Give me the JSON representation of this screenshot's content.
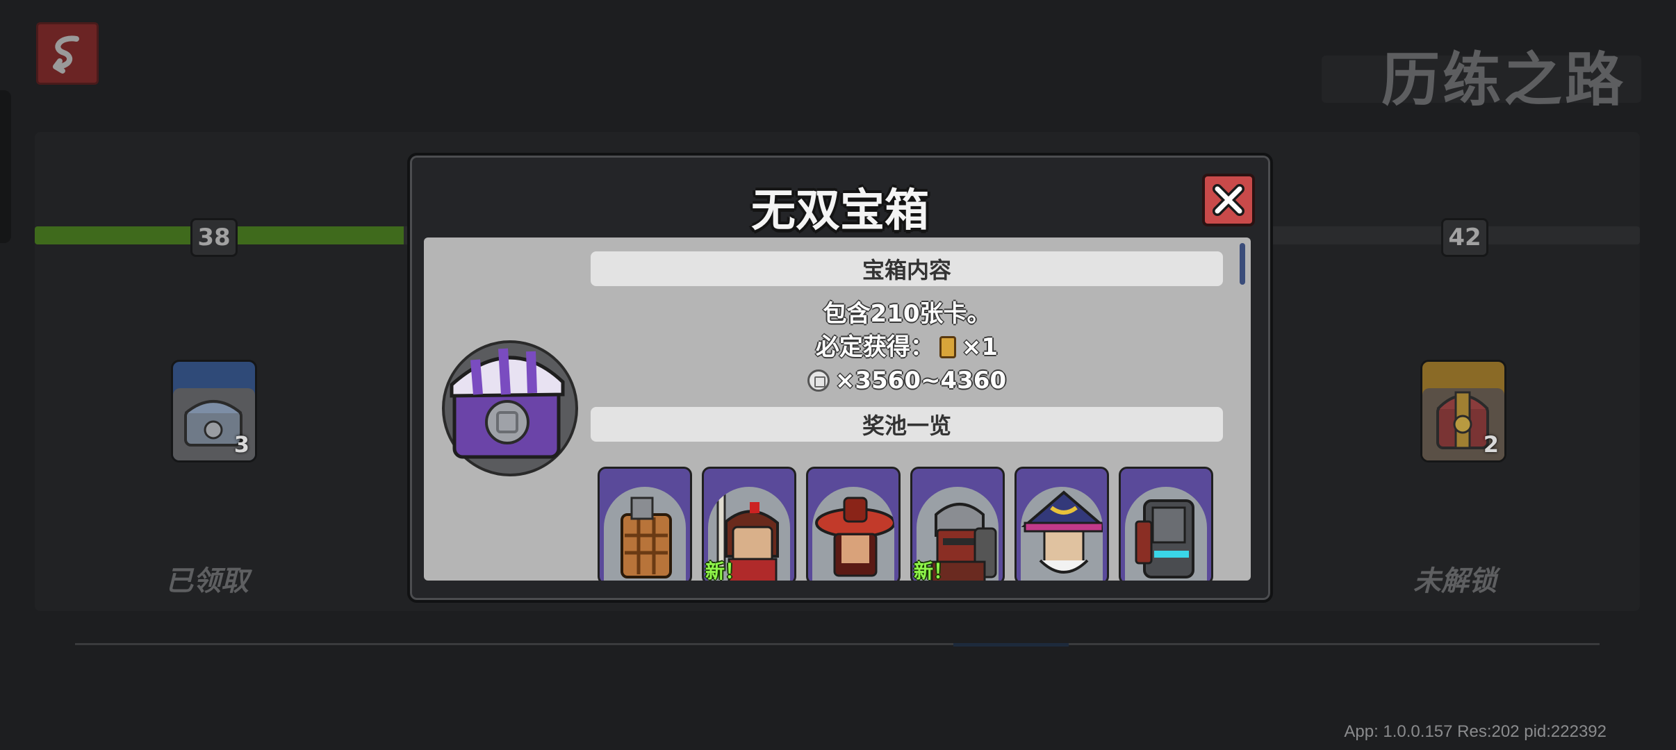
{
  "page": {
    "title": "历练之路",
    "version_info": "App: 1.0.0.157 Res:202 pid:222392"
  },
  "track": {
    "left_level": "38",
    "right_level": "42",
    "left_status": "已领取",
    "right_status": "未解锁",
    "left_chest_count": "3",
    "right_chest_count": "2",
    "progress_fraction": 0.23
  },
  "modal": {
    "title": "无双宝箱",
    "contents_header": "宝箱内容",
    "card_count_text": "包含210张卡。",
    "guaranteed_label": "必定获得：",
    "guaranteed_card_qty": "×1",
    "coin_range": "×3560~4360",
    "pool_header": "奖池一览",
    "cards": [
      {
        "name": "card-crate-hero",
        "new_label": ""
      },
      {
        "name": "card-swordsman-hero",
        "new_label": "新！"
      },
      {
        "name": "card-red-hat-hero",
        "new_label": ""
      },
      {
        "name": "card-armored-hero",
        "new_label": "新！"
      },
      {
        "name": "card-wizard-hero",
        "new_label": ""
      },
      {
        "name": "card-robot-hero",
        "new_label": ""
      }
    ]
  },
  "colors": {
    "progress_green": "#3f6a1c",
    "close_red": "#c94a4a",
    "card_purple": "#5a4a9a",
    "new_green": "#8ff54a"
  }
}
